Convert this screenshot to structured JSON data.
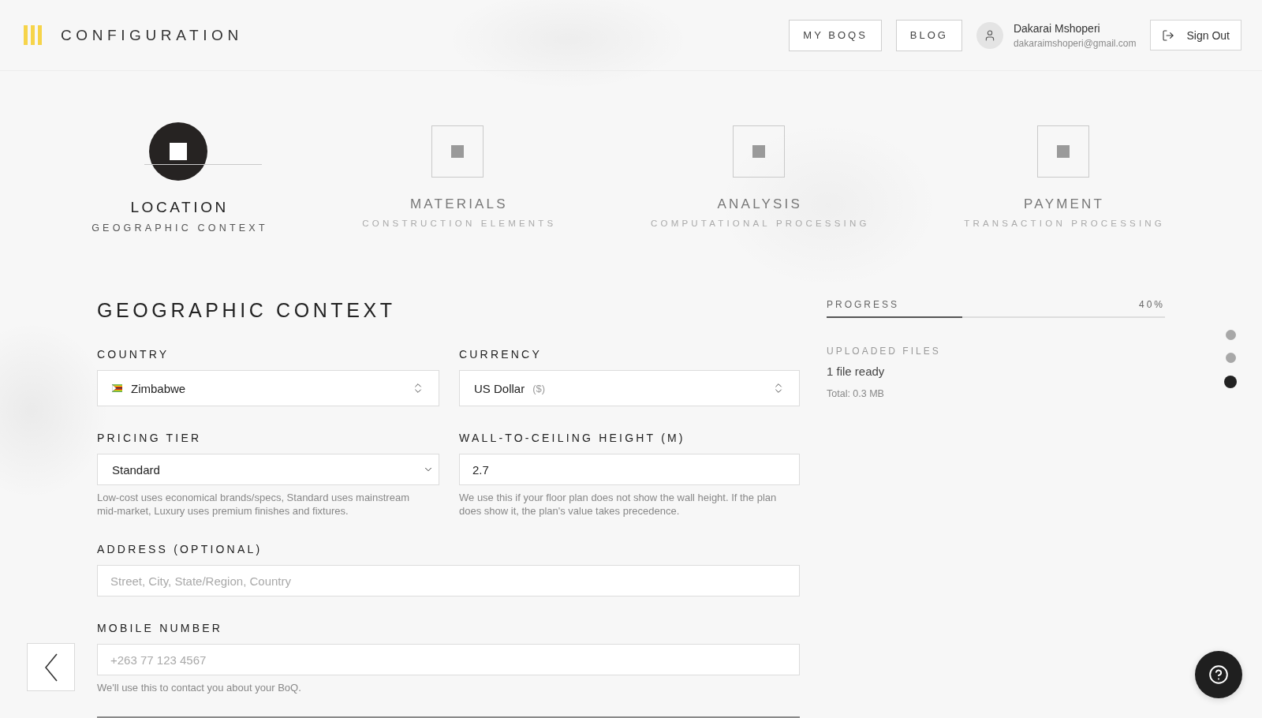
{
  "header": {
    "title": "CONFIGURATION",
    "nav": [
      {
        "label": "MY BOQS"
      },
      {
        "label": "BLOG"
      }
    ],
    "user": {
      "name": "Dakarai Mshoperi",
      "email": "dakaraimshoperi@gmail.com"
    },
    "sign_out": "Sign Out"
  },
  "steps": [
    {
      "title": "LOCATION",
      "subtitle": "GEOGRAPHIC CONTEXT",
      "selected": true
    },
    {
      "title": "MATERIALS",
      "subtitle": "CONSTRUCTION ELEMENTS",
      "selected": false
    },
    {
      "title": "ANALYSIS",
      "subtitle": "COMPUTATIONAL PROCESSING",
      "selected": false
    },
    {
      "title": "PAYMENT",
      "subtitle": "TRANSACTION PROCESSING",
      "selected": false
    }
  ],
  "form": {
    "heading": "GEOGRAPHIC CONTEXT",
    "rows": [
      [
        {
          "kind": "select",
          "label": "COUNTRY",
          "value": "Zimbabwe",
          "flag": true
        },
        {
          "kind": "select",
          "label": "CURRENCY",
          "value": "US Dollar",
          "suffix": "($)"
        }
      ],
      [
        {
          "kind": "dropdown",
          "label": "PRICING TIER",
          "value": "Standard",
          "help": "Low-cost uses economical brands/specs, Standard uses mainstream mid-market, Luxury uses premium finishes and fixtures."
        },
        {
          "kind": "input",
          "label": "WALL-TO-CEILING HEIGHT (M)",
          "value": "2.7",
          "help": "We use this if your floor plan does not show the wall height. If the plan does show it, the plan's value takes precedence."
        }
      ],
      [
        {
          "kind": "input",
          "label": "ADDRESS (OPTIONAL)",
          "placeholder": "Street, City, State/Region, Country"
        }
      ],
      [
        {
          "kind": "input",
          "label": "MOBILE NUMBER",
          "placeholder": "+263 77 123 4567",
          "help": "We'll use this to contact you about your BoQ."
        }
      ]
    ]
  },
  "progress": {
    "label": "PROGRESS",
    "reading": "40%",
    "level": 0.4
  },
  "uploads": {
    "title": "UPLOADED FILES",
    "status": "1 file ready",
    "total": "Total: 0.3 MB"
  },
  "section_dots": [
    {
      "selected": false
    },
    {
      "selected": false
    },
    {
      "selected": true
    }
  ]
}
